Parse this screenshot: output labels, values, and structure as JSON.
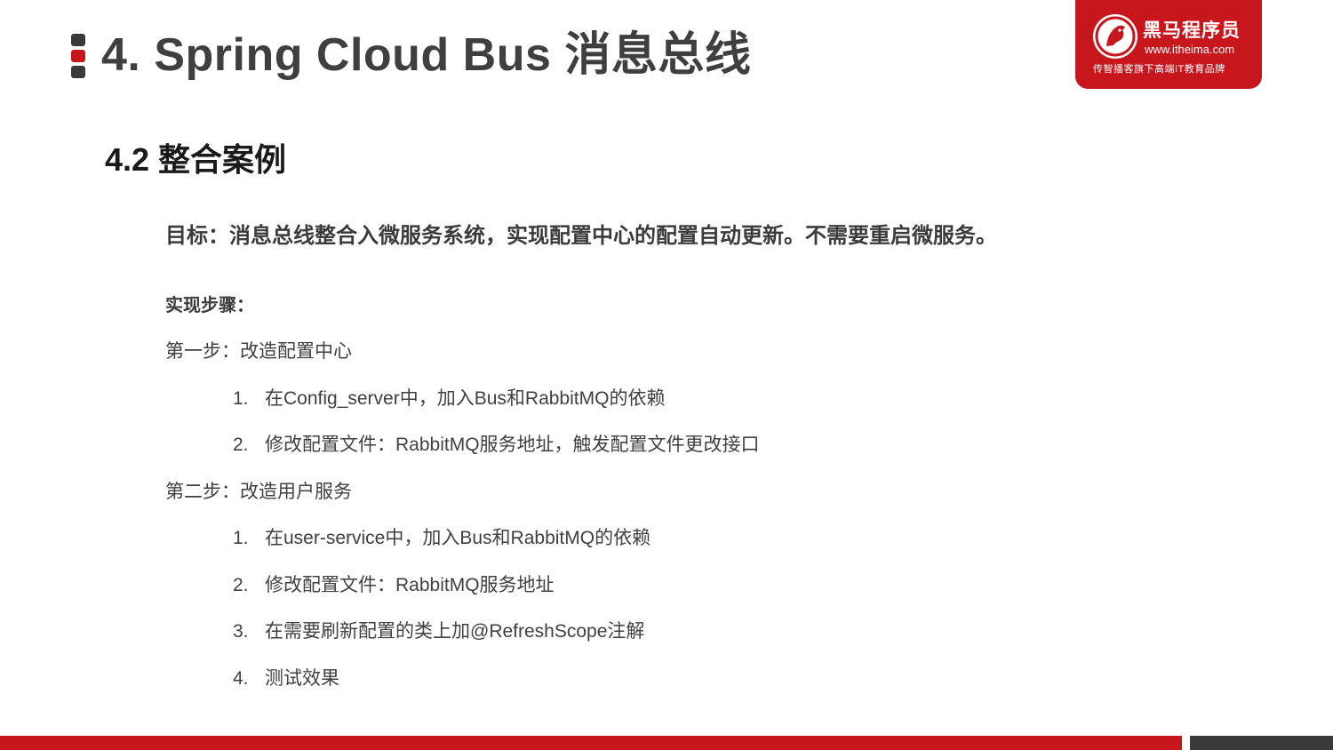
{
  "header": {
    "title": "4. Spring Cloud Bus 消息总线"
  },
  "logo": {
    "brand": "黑马程序员",
    "url": "www.itheima.com",
    "slogan": "传智播客旗下高端IT教育品牌",
    "icon": "horse-logo-icon"
  },
  "section": {
    "heading": "4.2 整合案例",
    "goal": "目标：消息总线整合入微服务系统，实现配置中心的配置自动更新。不需要重启微服务。",
    "steps_label": "实现步骤：",
    "steps": [
      {
        "title": "第一步：改造配置中心",
        "items": [
          {
            "num": "1.",
            "text": "在Config_server中，加入Bus和RabbitMQ的依赖"
          },
          {
            "num": "2.",
            "text": "修改配置文件：RabbitMQ服务地址，触发配置文件更改接口"
          }
        ]
      },
      {
        "title": "第二步：改造用户服务",
        "items": [
          {
            "num": "1.",
            "text": "在user-service中，加入Bus和RabbitMQ的依赖"
          },
          {
            "num": "2.",
            "text": "修改配置文件：RabbitMQ服务地址"
          },
          {
            "num": "3.",
            "text": "在需要刷新配置的类上加@RefreshScope注解"
          },
          {
            "num": "4.",
            "text": "测试效果"
          }
        ]
      }
    ]
  },
  "colors": {
    "accent": "#c8161d",
    "dark": "#3a3a3a",
    "title_text": "#3f3f3f",
    "body_text": "#404040"
  }
}
